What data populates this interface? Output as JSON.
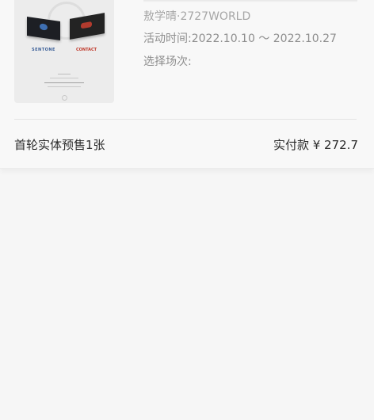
{
  "order": {
    "artist": "敖学晴·2727WORLD",
    "activity_time": "活动时间:2022.10.10 ～ 2022.10.27",
    "select_session": "选择场次:",
    "product_name": "首轮实体预售1张",
    "amount_label": "实付款 ¥ 272.7"
  },
  "thumbnail": {
    "tag_left": "SENTONE",
    "tag_right": "CONTACT"
  },
  "colors": {
    "background": "#f6f6f6",
    "text_primary": "#2b2b2b",
    "text_secondary": "#8e8e8e"
  }
}
